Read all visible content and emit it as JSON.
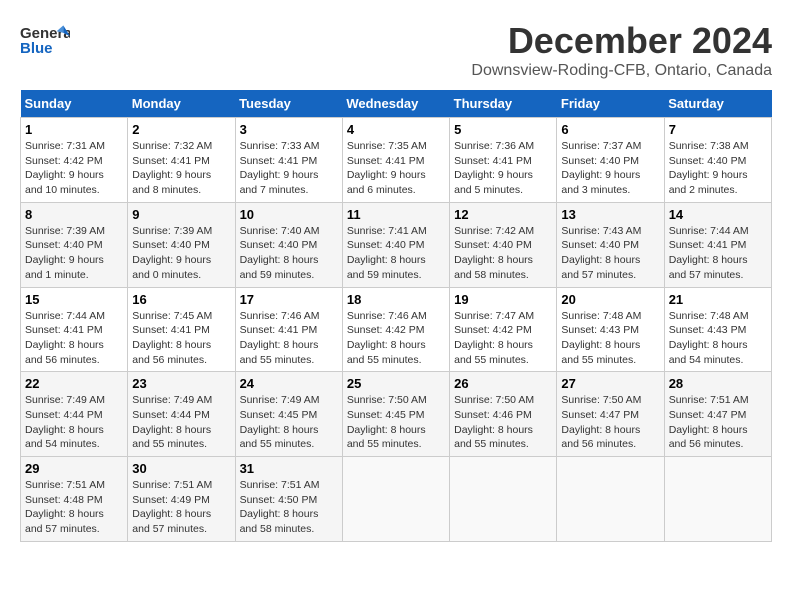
{
  "header": {
    "logo_line1": "General",
    "logo_line2": "Blue",
    "main_title": "December 2024",
    "subtitle": "Downsview-Roding-CFB, Ontario, Canada"
  },
  "calendar": {
    "days_of_week": [
      "Sunday",
      "Monday",
      "Tuesday",
      "Wednesday",
      "Thursday",
      "Friday",
      "Saturday"
    ],
    "weeks": [
      [
        {
          "day": "1",
          "sunrise": "Sunrise: 7:31 AM",
          "sunset": "Sunset: 4:42 PM",
          "daylight": "Daylight: 9 hours and 10 minutes."
        },
        {
          "day": "2",
          "sunrise": "Sunrise: 7:32 AM",
          "sunset": "Sunset: 4:41 PM",
          "daylight": "Daylight: 9 hours and 8 minutes."
        },
        {
          "day": "3",
          "sunrise": "Sunrise: 7:33 AM",
          "sunset": "Sunset: 4:41 PM",
          "daylight": "Daylight: 9 hours and 7 minutes."
        },
        {
          "day": "4",
          "sunrise": "Sunrise: 7:35 AM",
          "sunset": "Sunset: 4:41 PM",
          "daylight": "Daylight: 9 hours and 6 minutes."
        },
        {
          "day": "5",
          "sunrise": "Sunrise: 7:36 AM",
          "sunset": "Sunset: 4:41 PM",
          "daylight": "Daylight: 9 hours and 5 minutes."
        },
        {
          "day": "6",
          "sunrise": "Sunrise: 7:37 AM",
          "sunset": "Sunset: 4:40 PM",
          "daylight": "Daylight: 9 hours and 3 minutes."
        },
        {
          "day": "7",
          "sunrise": "Sunrise: 7:38 AM",
          "sunset": "Sunset: 4:40 PM",
          "daylight": "Daylight: 9 hours and 2 minutes."
        }
      ],
      [
        {
          "day": "8",
          "sunrise": "Sunrise: 7:39 AM",
          "sunset": "Sunset: 4:40 PM",
          "daylight": "Daylight: 9 hours and 1 minute."
        },
        {
          "day": "9",
          "sunrise": "Sunrise: 7:39 AM",
          "sunset": "Sunset: 4:40 PM",
          "daylight": "Daylight: 9 hours and 0 minutes."
        },
        {
          "day": "10",
          "sunrise": "Sunrise: 7:40 AM",
          "sunset": "Sunset: 4:40 PM",
          "daylight": "Daylight: 8 hours and 59 minutes."
        },
        {
          "day": "11",
          "sunrise": "Sunrise: 7:41 AM",
          "sunset": "Sunset: 4:40 PM",
          "daylight": "Daylight: 8 hours and 59 minutes."
        },
        {
          "day": "12",
          "sunrise": "Sunrise: 7:42 AM",
          "sunset": "Sunset: 4:40 PM",
          "daylight": "Daylight: 8 hours and 58 minutes."
        },
        {
          "day": "13",
          "sunrise": "Sunrise: 7:43 AM",
          "sunset": "Sunset: 4:40 PM",
          "daylight": "Daylight: 8 hours and 57 minutes."
        },
        {
          "day": "14",
          "sunrise": "Sunrise: 7:44 AM",
          "sunset": "Sunset: 4:41 PM",
          "daylight": "Daylight: 8 hours and 57 minutes."
        }
      ],
      [
        {
          "day": "15",
          "sunrise": "Sunrise: 7:44 AM",
          "sunset": "Sunset: 4:41 PM",
          "daylight": "Daylight: 8 hours and 56 minutes."
        },
        {
          "day": "16",
          "sunrise": "Sunrise: 7:45 AM",
          "sunset": "Sunset: 4:41 PM",
          "daylight": "Daylight: 8 hours and 56 minutes."
        },
        {
          "day": "17",
          "sunrise": "Sunrise: 7:46 AM",
          "sunset": "Sunset: 4:41 PM",
          "daylight": "Daylight: 8 hours and 55 minutes."
        },
        {
          "day": "18",
          "sunrise": "Sunrise: 7:46 AM",
          "sunset": "Sunset: 4:42 PM",
          "daylight": "Daylight: 8 hours and 55 minutes."
        },
        {
          "day": "19",
          "sunrise": "Sunrise: 7:47 AM",
          "sunset": "Sunset: 4:42 PM",
          "daylight": "Daylight: 8 hours and 55 minutes."
        },
        {
          "day": "20",
          "sunrise": "Sunrise: 7:48 AM",
          "sunset": "Sunset: 4:43 PM",
          "daylight": "Daylight: 8 hours and 55 minutes."
        },
        {
          "day": "21",
          "sunrise": "Sunrise: 7:48 AM",
          "sunset": "Sunset: 4:43 PM",
          "daylight": "Daylight: 8 hours and 54 minutes."
        }
      ],
      [
        {
          "day": "22",
          "sunrise": "Sunrise: 7:49 AM",
          "sunset": "Sunset: 4:44 PM",
          "daylight": "Daylight: 8 hours and 54 minutes."
        },
        {
          "day": "23",
          "sunrise": "Sunrise: 7:49 AM",
          "sunset": "Sunset: 4:44 PM",
          "daylight": "Daylight: 8 hours and 55 minutes."
        },
        {
          "day": "24",
          "sunrise": "Sunrise: 7:49 AM",
          "sunset": "Sunset: 4:45 PM",
          "daylight": "Daylight: 8 hours and 55 minutes."
        },
        {
          "day": "25",
          "sunrise": "Sunrise: 7:50 AM",
          "sunset": "Sunset: 4:45 PM",
          "daylight": "Daylight: 8 hours and 55 minutes."
        },
        {
          "day": "26",
          "sunrise": "Sunrise: 7:50 AM",
          "sunset": "Sunset: 4:46 PM",
          "daylight": "Daylight: 8 hours and 55 minutes."
        },
        {
          "day": "27",
          "sunrise": "Sunrise: 7:50 AM",
          "sunset": "Sunset: 4:47 PM",
          "daylight": "Daylight: 8 hours and 56 minutes."
        },
        {
          "day": "28",
          "sunrise": "Sunrise: 7:51 AM",
          "sunset": "Sunset: 4:47 PM",
          "daylight": "Daylight: 8 hours and 56 minutes."
        }
      ],
      [
        {
          "day": "29",
          "sunrise": "Sunrise: 7:51 AM",
          "sunset": "Sunset: 4:48 PM",
          "daylight": "Daylight: 8 hours and 57 minutes."
        },
        {
          "day": "30",
          "sunrise": "Sunrise: 7:51 AM",
          "sunset": "Sunset: 4:49 PM",
          "daylight": "Daylight: 8 hours and 57 minutes."
        },
        {
          "day": "31",
          "sunrise": "Sunrise: 7:51 AM",
          "sunset": "Sunset: 4:50 PM",
          "daylight": "Daylight: 8 hours and 58 minutes."
        },
        null,
        null,
        null,
        null
      ]
    ]
  }
}
